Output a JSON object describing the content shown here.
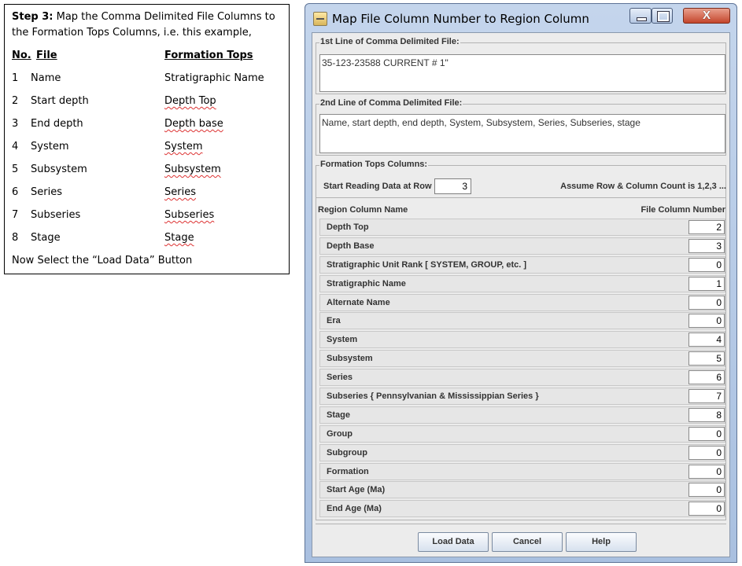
{
  "instructions": {
    "step_bold": "Step 3:",
    "step_text_1": " Map the Comma Delimited File Columns to",
    "step_text_2": "the Formation Tops Columns, i.e. this example,",
    "header_no": "No.",
    "header_file": "File",
    "header_tops": "Formation Tops",
    "rows": [
      {
        "no": "1",
        "file": "Name",
        "tops": "Stratigraphic Name"
      },
      {
        "no": "2",
        "file": "Start depth",
        "tops": "Depth Top"
      },
      {
        "no": "3",
        "file": "End depth",
        "tops": "Depth base"
      },
      {
        "no": "4",
        "file": "System",
        "tops": "System"
      },
      {
        "no": "5",
        "file": "Subsystem",
        "tops": "Subsystem"
      },
      {
        "no": "6",
        "file": "Series",
        "tops": "Series"
      },
      {
        "no": "7",
        "file": "Subseries",
        "tops": "Subseries"
      },
      {
        "no": "8",
        "file": "Stage",
        "tops": "Stage"
      }
    ],
    "footer": "Now Select the “Load Data” Button"
  },
  "window": {
    "title": "Map File Column Number to Region Column",
    "close_glyph": "X"
  },
  "first_line": {
    "legend": "1st Line of Comma Delimited File:",
    "value": "35-123-23588 CURRENT # 1\""
  },
  "second_line": {
    "legend": "2nd Line of Comma Delimited File:",
    "value": "Name, start depth, end depth, System, Subsystem, Series, Subseries, stage"
  },
  "tops": {
    "legend": "Formation Tops Columns:",
    "start_label": "Start Reading Data at Row",
    "start_value": "3",
    "assume_note": "Assume Row & Column Count is 1,2,3 ...",
    "col_name_header": "Region Column Name",
    "col_num_header": "File Column Number",
    "rows": [
      {
        "name": "Depth Top",
        "value": "2"
      },
      {
        "name": "Depth Base",
        "value": "3"
      },
      {
        "name": "Stratigraphic Unit Rank [ SYSTEM, GROUP, etc. ]",
        "value": "0"
      },
      {
        "name": "Stratigraphic Name",
        "value": "1"
      },
      {
        "name": "Alternate Name",
        "value": "0"
      },
      {
        "name": "Era",
        "value": "0"
      },
      {
        "name": "System",
        "value": "4"
      },
      {
        "name": "Subsystem",
        "value": "5"
      },
      {
        "name": "Series",
        "value": "6"
      },
      {
        "name": "Subseries { Pennsylvanian & Mississippian Series }",
        "value": "7"
      },
      {
        "name": "Stage",
        "value": "8"
      },
      {
        "name": "Group",
        "value": "0"
      },
      {
        "name": "Subgroup",
        "value": "0"
      },
      {
        "name": "Formation",
        "value": "0"
      },
      {
        "name": "Start Age (Ma)",
        "value": "0"
      },
      {
        "name": "End Age (Ma)",
        "value": "0"
      }
    ]
  },
  "buttons": {
    "load": "Load Data",
    "cancel": "Cancel",
    "help": "Help"
  }
}
